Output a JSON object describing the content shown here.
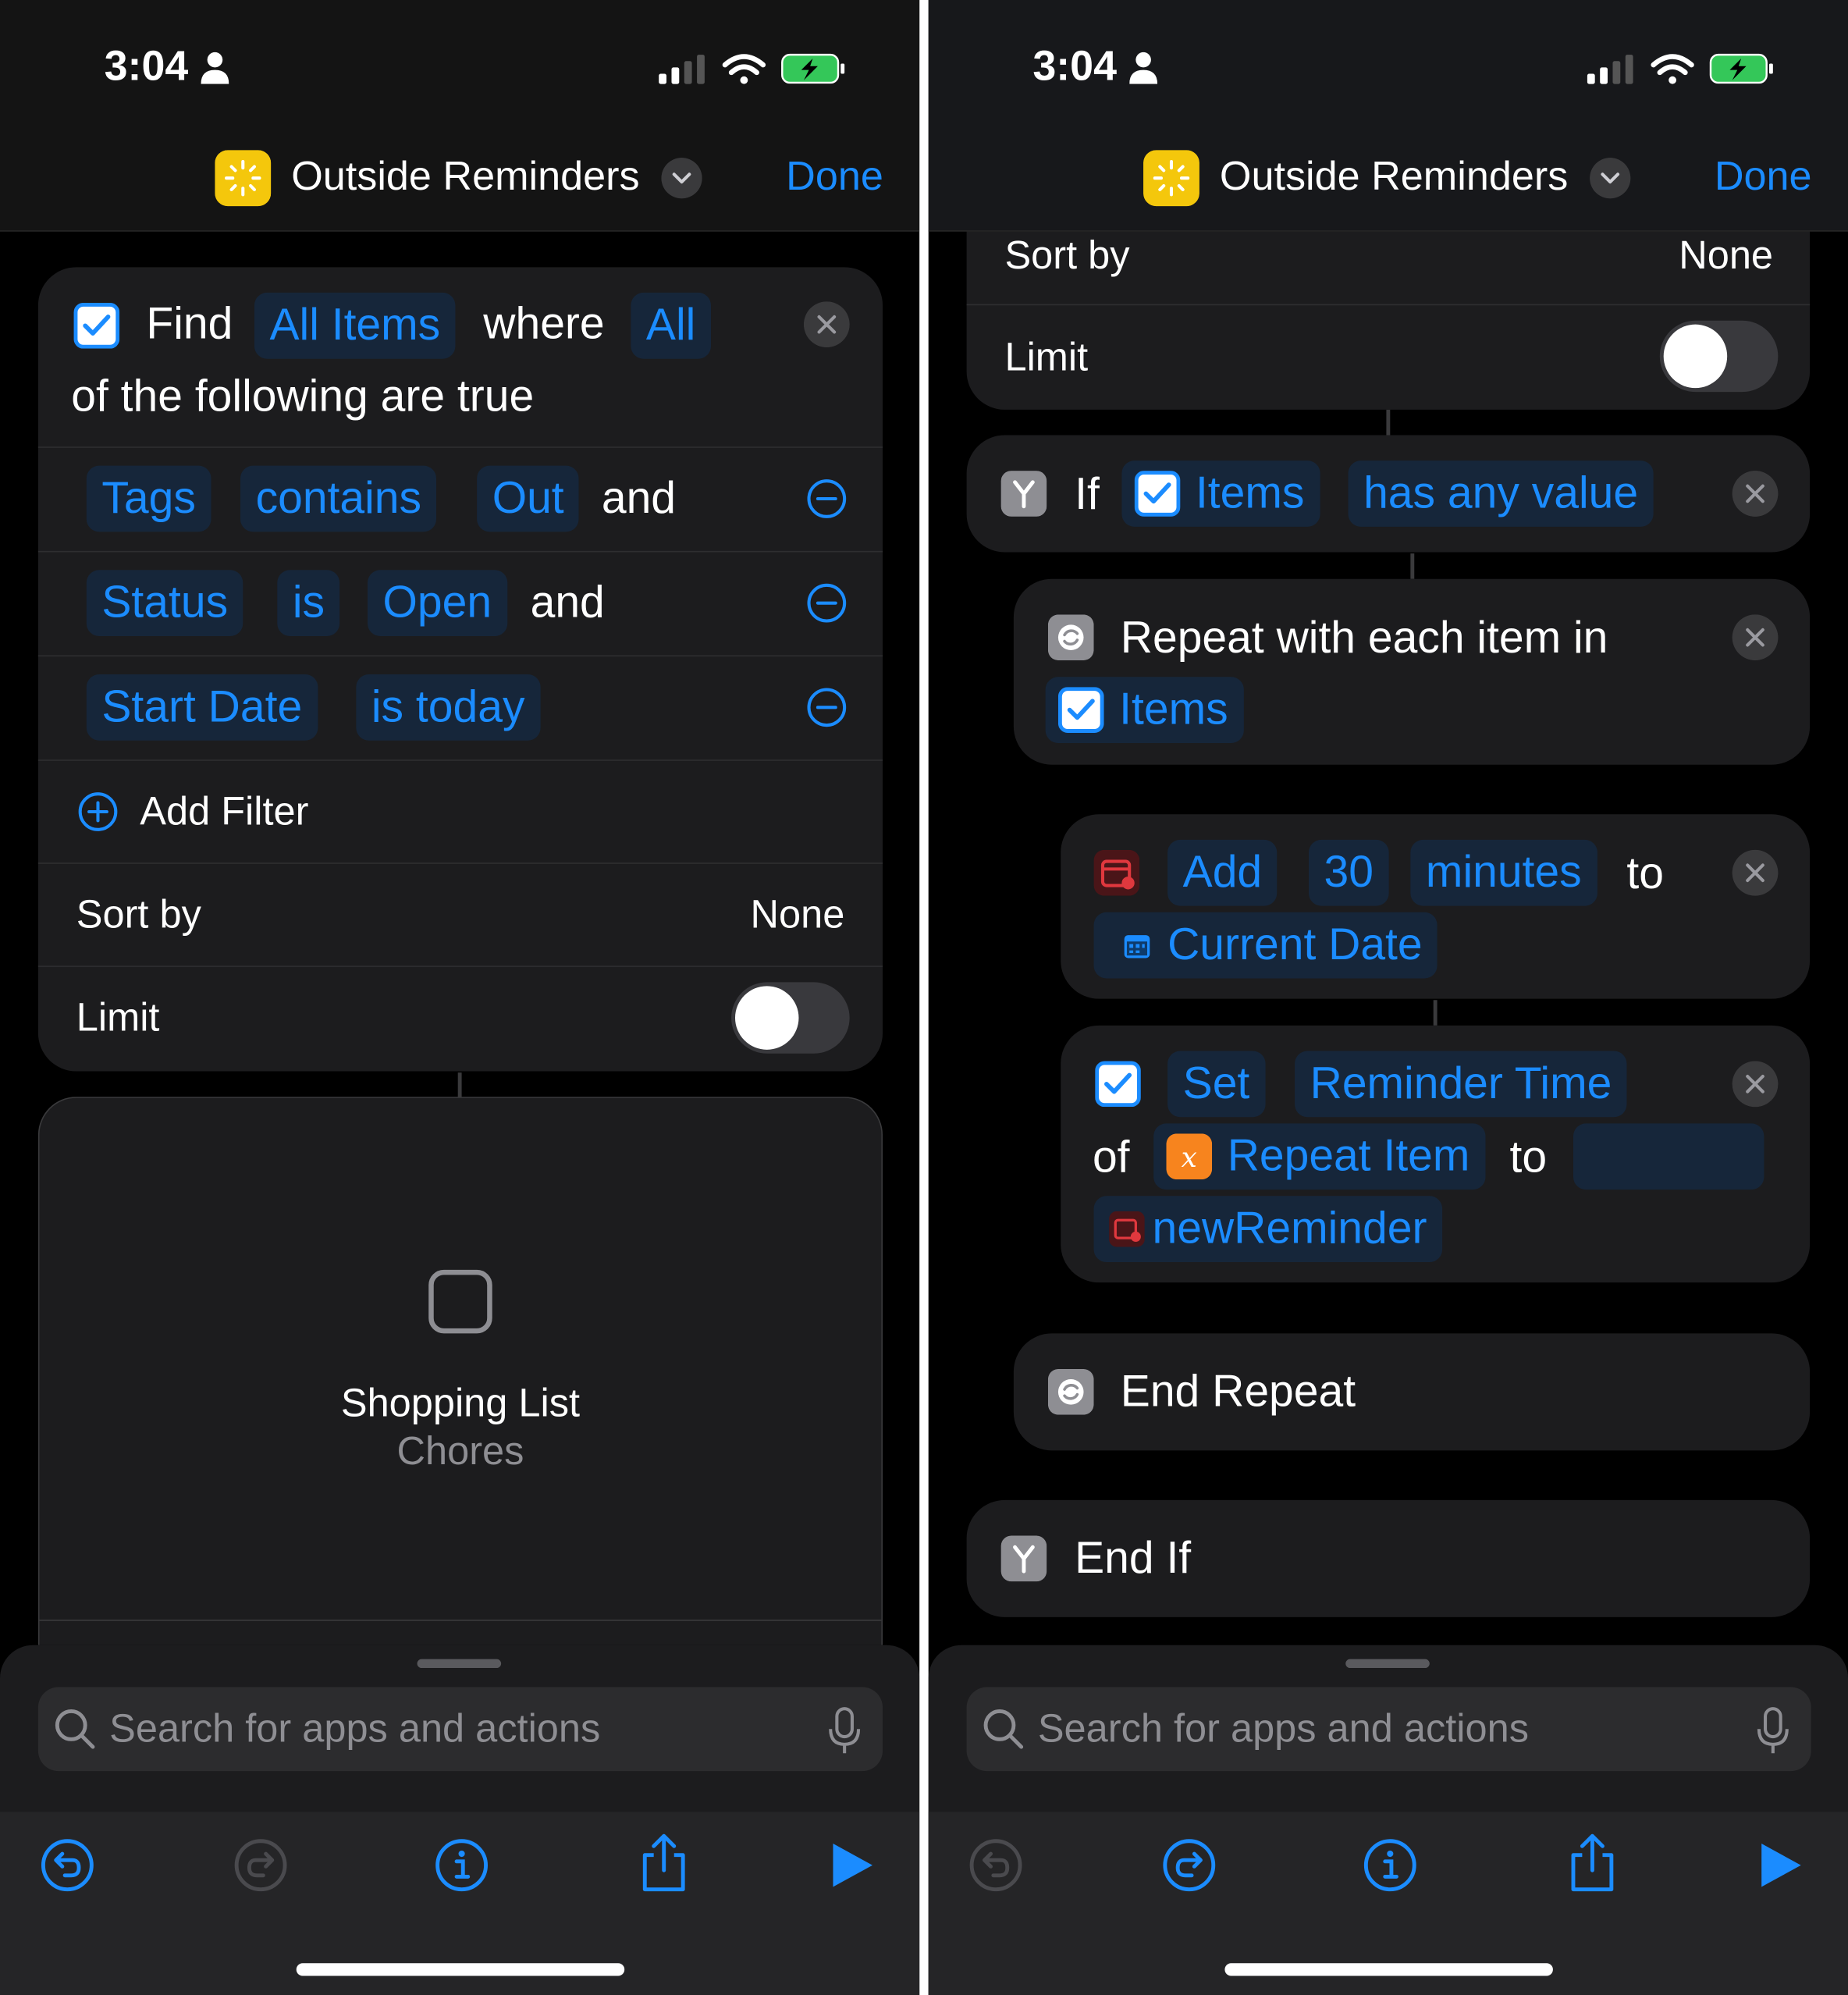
{
  "status_bar": {
    "time": "3:04"
  },
  "header": {
    "title": "Outside Reminders",
    "done_label": "Done"
  },
  "left": {
    "find": {
      "find_word": "Find",
      "source": "All Items",
      "where_word": "where",
      "match": "All",
      "continuation": "of the following are true"
    },
    "filters": [
      {
        "field": "Tags",
        "op": "contains",
        "value": "Out",
        "join": "and"
      },
      {
        "field": "Status",
        "op": "is",
        "value": "Open",
        "join": "and"
      },
      {
        "field": "Start Date",
        "op": "is today",
        "value": "",
        "join": ""
      }
    ],
    "add_filter": "Add Filter",
    "sort_by": {
      "label": "Sort by",
      "value": "None"
    },
    "limit": {
      "label": "Limit",
      "enabled": false
    },
    "preview": {
      "line1": "Shopping List",
      "line2": "Chores"
    }
  },
  "right": {
    "sort_by": {
      "label": "Sort by",
      "value": "None"
    },
    "limit": {
      "label": "Limit",
      "enabled": false
    },
    "if_block": {
      "keyword": "If",
      "variable": "Items",
      "condition": "has any value"
    },
    "repeat": {
      "text": "Repeat with each item in",
      "variable": "Items"
    },
    "add_time": {
      "action": "Add",
      "amount": "30",
      "unit": "minutes",
      "to_word": "to",
      "target": "Current Date"
    },
    "set_block": {
      "action": "Set",
      "property": "Reminder Time",
      "of_word": "of",
      "item": "Repeat Item",
      "to_word": "to",
      "value": "newReminder"
    },
    "end_repeat": "End Repeat",
    "end_if": "End If"
  },
  "search": {
    "placeholder": "Search for apps and actions"
  },
  "toolbar": {
    "buttons": [
      "undo-icon",
      "redo-icon",
      "info-icon",
      "share-icon",
      "play-icon"
    ]
  },
  "colors": {
    "accent": "#1b8cff",
    "background": "#000000",
    "card": "#1c1c1e",
    "app_icon": "#f4c70c",
    "calendar_icon": "#e0383e",
    "variable_icon": "#f7841e"
  }
}
